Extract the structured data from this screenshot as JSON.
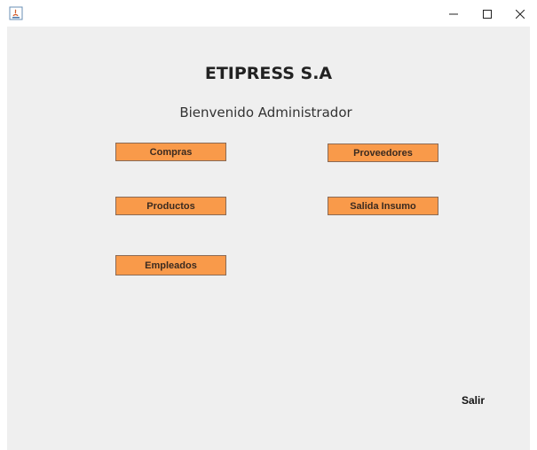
{
  "titlebar": {
    "icon": "java-app-icon",
    "controls": {
      "minimize_icon": "minimize-icon",
      "maximize_icon": "maximize-icon",
      "close_icon": "close-icon"
    }
  },
  "header": {
    "title": "ETIPRESS S.A",
    "welcome": "Bienvenido Administrador"
  },
  "menu": {
    "compras": "Compras",
    "proveedores": "Proveedores",
    "productos": "Productos",
    "salida_insumo": "Salida Insumo",
    "empleados": "Empleados"
  },
  "footer": {
    "exit_label": "Salir"
  },
  "colors": {
    "button_fill": "#f99a4a",
    "button_border": "#8a6a55",
    "panel_background": "#efefef"
  }
}
